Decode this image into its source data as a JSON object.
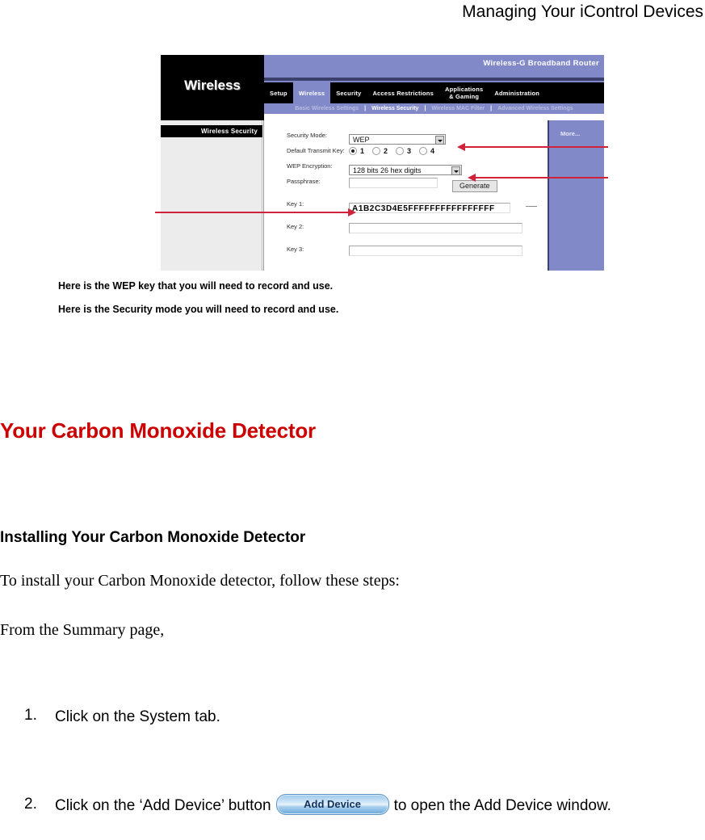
{
  "header": {
    "title": "Managing Your iControl Devices"
  },
  "figure": {
    "model": "Wireless-G Broadband Router",
    "brand": "Wireless",
    "tabs": [
      {
        "label": "Setup",
        "active": false
      },
      {
        "label": "Wireless",
        "active": true
      },
      {
        "label": "Security",
        "active": false
      },
      {
        "label": "Access Restrictions",
        "active": false
      },
      {
        "label": "Applications\n& Gaming",
        "active": false
      },
      {
        "label": "Administration",
        "active": false
      }
    ],
    "subnav": [
      {
        "label": "Basic Wireless Settings",
        "active": false
      },
      {
        "label": "Wireless Security",
        "active": true
      },
      {
        "label": "Wireless MAC Filter",
        "active": false
      },
      {
        "label": "Advanced Wireless Settings",
        "active": false
      }
    ],
    "subnav_separator": "|",
    "sidebar_title": "Wireless Security",
    "more_link": "More...",
    "form": {
      "security_mode": {
        "label": "Security Mode:",
        "value": "WEP"
      },
      "default_transmit_key": {
        "label": "Default Transmit Key:",
        "options": [
          "1",
          "2",
          "3",
          "4"
        ],
        "selected": "1"
      },
      "wep_encryption": {
        "label": "WEP Encryption:",
        "value": "128 bits 26 hex digits"
      },
      "passphrase": {
        "label": "Passphrase:",
        "value": "",
        "button": "Generate"
      },
      "key1": {
        "label": "Key 1:",
        "value": "A1B2C3D4E5FFFFFFFFFFFFFFFF"
      },
      "key2": {
        "label": "Key 2:",
        "value": ""
      },
      "key3": {
        "label": "Key 3:",
        "value": ""
      }
    }
  },
  "captions": {
    "wep_key": "Here is the WEP key that you will need to record and use.",
    "security_mode": "Here is the Security mode you will need to record and use."
  },
  "content": {
    "section_title": "Your Carbon Monoxide Detector",
    "subsection_title": "Installing Your Carbon Monoxide Detector",
    "paragraph_1": "To install your Carbon Monoxide detector, follow these steps:",
    "paragraph_2": "From the Summary page,",
    "steps": [
      {
        "number": "1.",
        "text": "Click on the System tab."
      },
      {
        "number": "2.",
        "text_before": "Click on the ‘Add Device’ button",
        "button_label": "Add Device",
        "text_after": "to open the Add Device window."
      }
    ]
  },
  "colors": {
    "heading_red": "#cc0000",
    "router_purple": "#8289c9",
    "annotation_red": "#d0223b",
    "button_blue": "#11335c"
  }
}
